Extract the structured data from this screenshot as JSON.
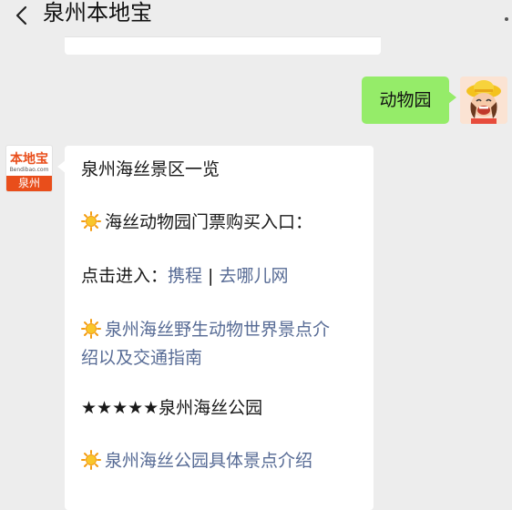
{
  "header": {
    "title": "泉州本地宝"
  },
  "chat": {
    "user_message": "动物园",
    "bot_avatar": {
      "logo_text": "本地宝",
      "logo_sub": "Bendibao.com",
      "city": "泉州"
    },
    "reply": {
      "line1": "泉州海丝景区一览",
      "line2": "海丝动物园门票购买入口：",
      "click_prefix": "点击进入：",
      "link_ctrip": "携程",
      "separator": "|",
      "link_qunar": "去哪儿网",
      "link_world_a": "泉州海丝野生动物世界景点介",
      "link_world_b": "绍以及交通指南",
      "line_park": "★★★★★泉州海丝公园",
      "link_park": "泉州海丝公园具体景点介绍"
    }
  },
  "icons": {
    "back": "chevron-left-icon",
    "sun": "sun-emoji-icon",
    "menu": "more-dots-icon"
  },
  "colors": {
    "background": "#ededed",
    "user_bubble": "#95ec69",
    "link": "#576b95",
    "brand": "#e94e1b"
  }
}
